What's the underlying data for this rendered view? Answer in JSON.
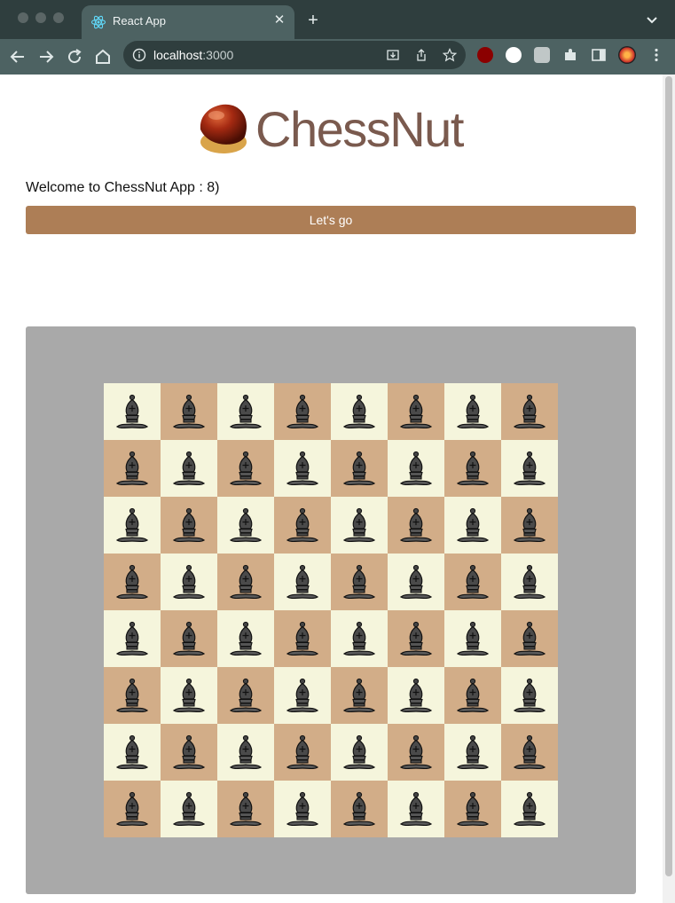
{
  "browser": {
    "tab": {
      "title": "React App",
      "favicon": "react-icon"
    },
    "url": {
      "host": "localhost",
      "port": ":3000"
    },
    "colors": {
      "tabstrip": "#2f3e3e",
      "toolbar": "#4d6262"
    }
  },
  "page": {
    "logo_text": "ChessNut",
    "welcome_text": "Welcome to ChessNut App : 8)",
    "go_button_label": "Let's go"
  },
  "board": {
    "rows": 8,
    "cols": 8,
    "light_color": "#f5f5dc",
    "dark_color": "#d2ad88",
    "piece": "black-bishop",
    "top_left_square": "light"
  }
}
